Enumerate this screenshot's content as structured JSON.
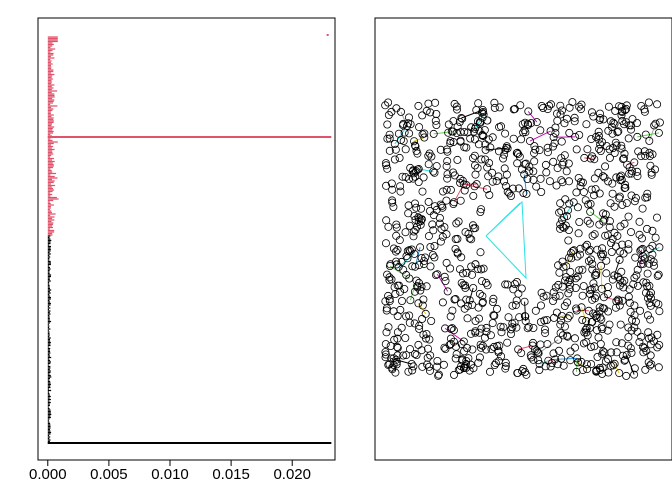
{
  "chart_data": [
    {
      "type": "line",
      "title": "",
      "xlabel": "",
      "ylabel": "",
      "xlim": [
        -0.0008,
        0.0235
      ],
      "x_ticks": [
        0.0,
        0.005,
        0.01,
        0.015,
        0.02
      ],
      "x_tick_labels": [
        "0.000",
        "0.005",
        "0.010",
        "0.015",
        "0.020"
      ],
      "y_axis_shown": false,
      "grid": false,
      "colors": {
        "lower_series": "#000000",
        "upper_series": "#DF536B",
        "frame": "#000000"
      },
      "series": [
        {
          "color": "#000000",
          "description_ref": "lower-block",
          "x_range": [
            0.0,
            0.0001
          ],
          "long_segment_x": 0.0232
        },
        {
          "color": "#DF536B",
          "description_ref": "upper-block",
          "x_range": [
            0.0,
            0.0008
          ],
          "long_segment_x": 0.0232,
          "isolated_point_x": 0.0229
        }
      ]
    },
    {
      "type": "scatter",
      "title": "",
      "xlabel": "",
      "ylabel": "",
      "axes_shown": false,
      "grid": false,
      "shape": "square-annulus",
      "marker": "open-circle",
      "edge_colors": [
        "#000000",
        "#DF536B",
        "#61D04F",
        "#2297E6",
        "#28E2E5",
        "#CD0BBC",
        "#F5C710",
        "#9E9E9E"
      ]
    }
  ]
}
